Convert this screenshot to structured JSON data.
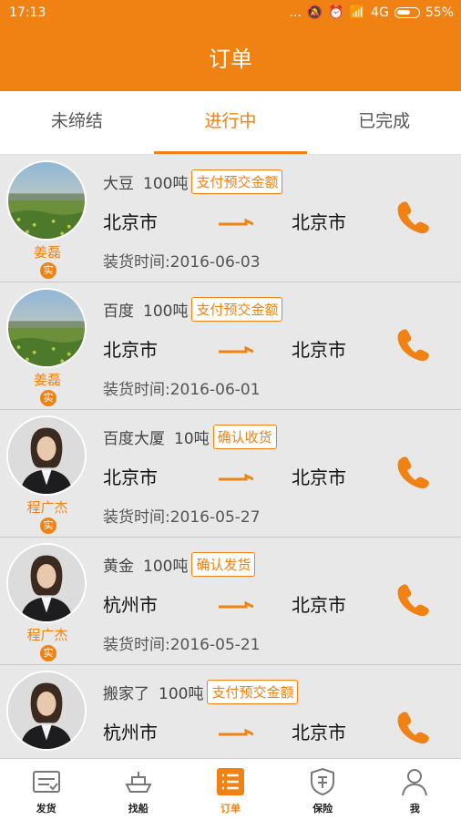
{
  "status_bar": {
    "time": "17:13",
    "dots": "...",
    "network": "4G",
    "battery": "55%"
  },
  "header": {
    "title": "订单"
  },
  "tabs": [
    {
      "label": "未缔结"
    },
    {
      "label": "进行中"
    },
    {
      "label": "已完成"
    }
  ],
  "active_tab": 1,
  "orders": [
    {
      "name": "姜磊",
      "badge": "实",
      "avatar": "landscape",
      "cargo": "大豆",
      "weight": "100吨",
      "action": "支付预交金额",
      "from": "北京市",
      "to": "北京市",
      "load_time": "装货时间:2016-06-03"
    },
    {
      "name": "姜磊",
      "badge": "实",
      "avatar": "landscape",
      "cargo": "百度",
      "weight": "100吨",
      "action": "支付预交金额",
      "from": "北京市",
      "to": "北京市",
      "load_time": "装货时间:2016-06-01"
    },
    {
      "name": "程广杰",
      "badge": "实",
      "avatar": "person",
      "cargo": "百度大厦",
      "weight": "10吨",
      "action": "确认收货",
      "from": "北京市",
      "to": "北京市",
      "load_time": "装货时间:2016-05-27"
    },
    {
      "name": "程广杰",
      "badge": "实",
      "avatar": "person",
      "cargo": "黄金",
      "weight": "100吨",
      "action": "确认发货",
      "from": "杭州市",
      "to": "北京市",
      "load_time": "装货时间:2016-05-21"
    },
    {
      "name": "",
      "badge": "",
      "avatar": "person",
      "cargo": "搬家了",
      "weight": "100吨",
      "action": "支付预交金额",
      "from": "杭州市",
      "to": "北京市",
      "load_time": ""
    }
  ],
  "bottom_nav": [
    {
      "label": "发货",
      "icon": "shipment-icon"
    },
    {
      "label": "找船",
      "icon": "ship-icon"
    },
    {
      "label": "订单",
      "icon": "order-list-icon"
    },
    {
      "label": "保险",
      "icon": "insurance-shield-icon"
    },
    {
      "label": "我",
      "icon": "profile-icon"
    }
  ],
  "active_nav": 2,
  "colors": {
    "accent": "#f08214",
    "card_bg": "#e8e8e8"
  }
}
